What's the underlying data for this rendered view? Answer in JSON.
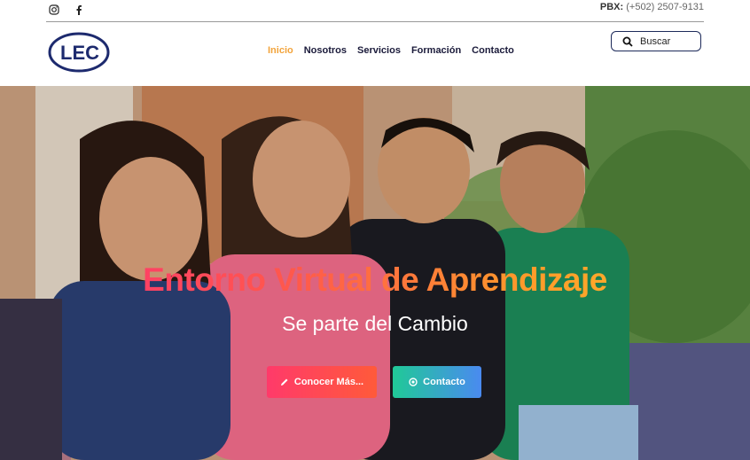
{
  "topbar": {
    "social": [
      {
        "name": "instagram-icon"
      },
      {
        "name": "facebook-icon"
      }
    ],
    "phone_label": "PBX:",
    "phone_number": "(+502) 2507-9131"
  },
  "header": {
    "logo_text": "LEC",
    "nav": [
      {
        "label": "Inicio",
        "active": true
      },
      {
        "label": "Nosotros",
        "active": false
      },
      {
        "label": "Servicios",
        "active": false
      },
      {
        "label": "Formación",
        "active": false
      },
      {
        "label": "Contacto",
        "active": false
      }
    ],
    "search_placeholder": "Buscar"
  },
  "hero": {
    "title": "Entorno Virtual de Aprendizaje",
    "subtitle": "Se parte del Cambio",
    "buttons": [
      {
        "label": "Conocer Más...",
        "icon": "pencil-icon"
      },
      {
        "label": "Contacto",
        "icon": "circle-dot-icon"
      }
    ]
  },
  "colors": {
    "accent": "#f2a33a",
    "nav_text": "#1a1a3a",
    "button_more": "#ff3a6a",
    "button_contact": "#20c997"
  }
}
